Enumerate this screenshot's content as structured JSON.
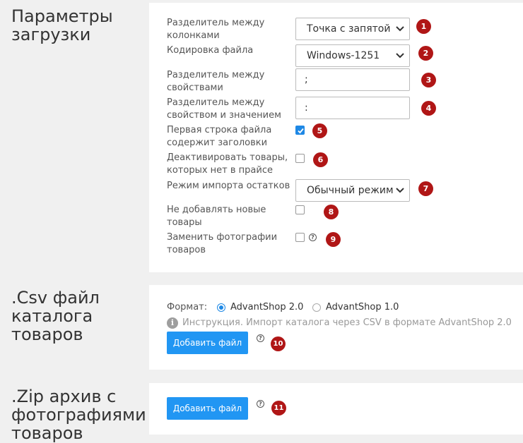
{
  "upload_params": {
    "title": [
      "Параметры",
      "загрузки"
    ],
    "column_separator": {
      "label": [
        "Разделитель между",
        "колонками"
      ],
      "value": "Точка с запятой",
      "badge": "1"
    },
    "encoding": {
      "label": [
        "Кодировка файла"
      ],
      "value": "Windows-1251",
      "badge": "2"
    },
    "property_separator": {
      "label": [
        "Разделитель между",
        "свойствами"
      ],
      "value": ";",
      "badge": "3"
    },
    "property_value_separator": {
      "label": [
        "Разделитель между",
        "свойством и значением"
      ],
      "value": ":",
      "badge": "4"
    },
    "first_row_headers": {
      "label": [
        "Первая строка файла",
        "содержит заголовки"
      ],
      "checked": true,
      "badge": "5"
    },
    "deactivate_missing": {
      "label": [
        "Деактивировать товары,",
        "которых нет в прайсе"
      ],
      "checked": false,
      "badge": "6"
    },
    "stock_import_mode": {
      "label": [
        "Режим импорта остатков"
      ],
      "value": "Обычный режим",
      "badge": "7"
    },
    "no_new_products": {
      "label": [
        "Не добавлять новые",
        "товары"
      ],
      "checked": false,
      "badge": "8"
    },
    "replace_photos": {
      "label": [
        "Заменить фотографии",
        "товаров"
      ],
      "checked": false,
      "help": "?",
      "badge": "9"
    }
  },
  "csv_section": {
    "title": [
      ".Csv файл",
      "каталога",
      "товаров"
    ],
    "format_label": "Формат:",
    "formats": [
      {
        "label": "AdvantShop 2.0",
        "selected": true
      },
      {
        "label": "AdvantShop 1.0",
        "selected": false
      }
    ],
    "info_icon": "i",
    "instruction": "Инструкция. Импорт каталога через CSV в формате AdvantShop 2.0",
    "button": "Добавить файл",
    "help": "?",
    "badge": "10"
  },
  "zip_section": {
    "title": [
      ".Zip архив с",
      "фотографиями",
      "товаров"
    ],
    "button": "Добавить файл",
    "help": "?",
    "badge": "11"
  },
  "colors": {
    "accent": "#2196f3",
    "badge": "#b01616",
    "panel": "#ffffff",
    "background": "#f0f0f0"
  }
}
